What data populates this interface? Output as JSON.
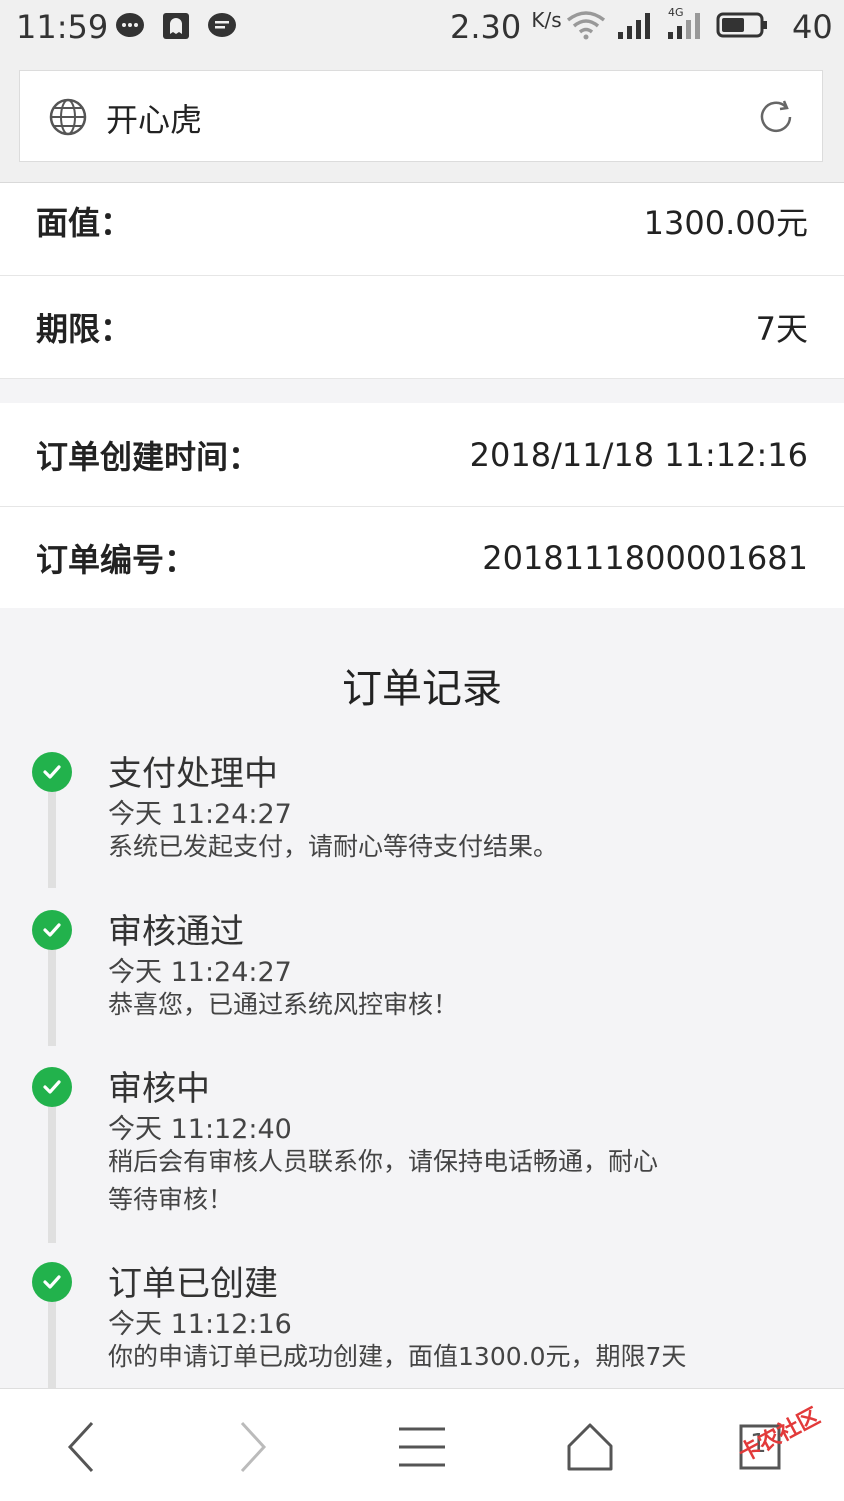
{
  "status_bar": {
    "time": "11:59",
    "speed": "2.30",
    "speed_unit": "K/s",
    "network_label": "4G",
    "battery": "40",
    "icons": [
      "chat-bubble-icon",
      "ghost-app-icon",
      "message-icon",
      "wifi-icon",
      "signal-icon",
      "signal-4g-icon",
      "battery-icon"
    ]
  },
  "browser": {
    "page_title": "开心虎",
    "globe_icon": "globe-icon",
    "refresh_icon": "refresh-icon"
  },
  "order_info": {
    "face_value": {
      "label": "面值：",
      "value": "1300.00元"
    },
    "term": {
      "label": "期限：",
      "value": "7天"
    },
    "created_time": {
      "label": "订单创建时间：",
      "value": "2018/11/18 11:12:16"
    },
    "order_no": {
      "label": "订单编号：",
      "value": "2018111800001681"
    }
  },
  "records": {
    "title": "订单记录",
    "items": [
      {
        "name": "支付处理中",
        "time": "今天 11:24:27",
        "desc": "系统已发起支付，请耐心等待支付结果。"
      },
      {
        "name": "审核通过",
        "time": "今天 11:24:27",
        "desc": "恭喜您，已通过系统风控审核！"
      },
      {
        "name": "审核中",
        "time": "今天 11:12:40",
        "desc": "稍后会有审核人员联系你，请保持电话畅通，耐心等待审核！"
      },
      {
        "name": "订单已创建",
        "time": "今天 11:12:16",
        "desc": "你的申请订单已成功创建，面值1300.0元，期限7天"
      }
    ]
  },
  "bottom_nav": {
    "tab_count": "1",
    "watermark": "卡农社区",
    "colors": {
      "check": "#22b24c",
      "nav": "#555555"
    }
  }
}
